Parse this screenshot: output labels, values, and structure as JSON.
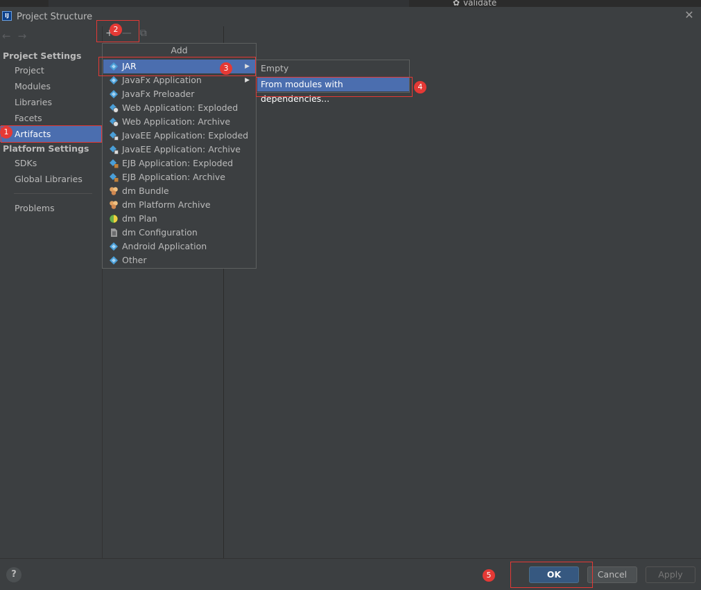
{
  "background_header": {
    "validate_label": "validate"
  },
  "window": {
    "title": "Project Structure"
  },
  "sidebar": {
    "project_settings_header": "Project Settings",
    "project_items": [
      "Project",
      "Modules",
      "Libraries",
      "Facets",
      "Artifacts"
    ],
    "platform_settings_header": "Platform Settings",
    "platform_items": [
      "SDKs",
      "Global Libraries"
    ],
    "problems": "Problems",
    "selected": "Artifacts"
  },
  "popup": {
    "title": "Add",
    "items": [
      {
        "label": "JAR",
        "icon": "artifact-icon",
        "submenu": true
      },
      {
        "label": "JavaFx Application",
        "icon": "artifact-icon",
        "submenu": true
      },
      {
        "label": "JavaFx Preloader",
        "icon": "artifact-icon"
      },
      {
        "label": "Web Application: Exploded",
        "icon": "web-artifact-icon"
      },
      {
        "label": "Web Application: Archive",
        "icon": "web-artifact-icon"
      },
      {
        "label": "JavaEE Application: Exploded",
        "icon": "javaee-artifact-icon"
      },
      {
        "label": "JavaEE Application: Archive",
        "icon": "javaee-artifact-icon"
      },
      {
        "label": "EJB Application: Exploded",
        "icon": "ejb-artifact-icon"
      },
      {
        "label": "EJB Application: Archive",
        "icon": "ejb-artifact-icon"
      },
      {
        "label": "dm Bundle",
        "icon": "bundle-icon"
      },
      {
        "label": "dm Platform Archive",
        "icon": "bundle-icon"
      },
      {
        "label": "dm Plan",
        "icon": "globe-icon"
      },
      {
        "label": "dm Configuration",
        "icon": "document-icon"
      },
      {
        "label": "Android Application",
        "icon": "artifact-icon"
      },
      {
        "label": "Other",
        "icon": "artifact-icon"
      }
    ]
  },
  "submenu": {
    "items": [
      "Empty",
      "From modules with dependencies..."
    ]
  },
  "buttons": {
    "help": "?",
    "ok": "OK",
    "cancel": "Cancel",
    "apply": "Apply"
  },
  "annotations": [
    "1",
    "2",
    "3",
    "4",
    "5"
  ],
  "colors": {
    "selection": "#4b6eaf",
    "annotation": "#e53935",
    "background": "#3c3f41",
    "ok_button": "#365880"
  }
}
